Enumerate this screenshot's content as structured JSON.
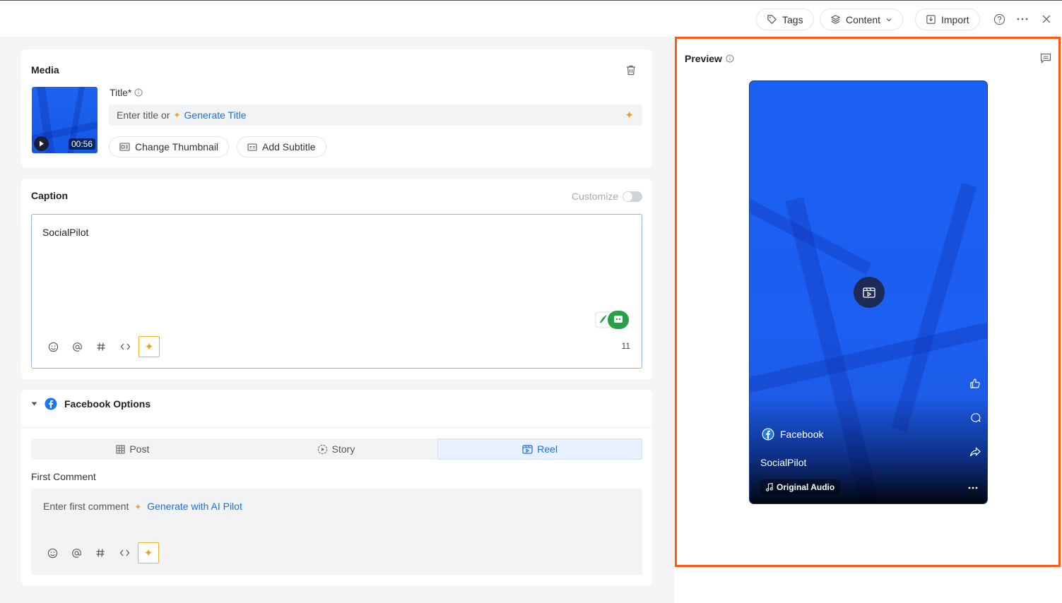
{
  "toolbar": {
    "tags_label": "Tags",
    "content_label": "Content",
    "import_label": "Import"
  },
  "media": {
    "section_title": "Media",
    "duration": "00:56",
    "title_label": "Title*",
    "title_placeholder": "Enter title or",
    "generate_title_label": "Generate Title",
    "change_thumbnail_label": "Change Thumbnail",
    "add_subtitle_label": "Add Subtitle"
  },
  "caption": {
    "section_title": "Caption",
    "customize_label": "Customize",
    "text": "SocialPilot",
    "char_count": "11"
  },
  "facebook_options": {
    "section_title": "Facebook Options",
    "tabs": [
      {
        "label": "Post"
      },
      {
        "label": "Story"
      },
      {
        "label": "Reel"
      }
    ],
    "active_tab": "Reel",
    "first_comment_label": "First Comment",
    "first_comment_placeholder": "Enter first comment",
    "generate_ai_label": "Generate with AI Pilot"
  },
  "preview": {
    "title": "Preview",
    "account_name": "Facebook",
    "caption": "SocialPilot",
    "audio_label": "Original Audio"
  },
  "colors": {
    "accent": "#1d6fd8",
    "highlight_border": "#ff5a12",
    "ai_spark": "#f0a020",
    "video_blue": "#1b60f2"
  }
}
